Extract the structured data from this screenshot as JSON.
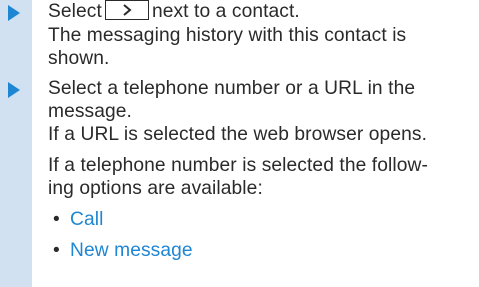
{
  "steps": [
    {
      "before_key": "Select",
      "key_icon": "chevron-right-icon",
      "after_key": "next to a contact.",
      "result": [
        "The messaging history with this contact is",
        "shown."
      ]
    },
    {
      "lines": [
        "Select a telephone number or a URL in the",
        "message."
      ],
      "result": [
        "If a URL is selected the web browser opens."
      ],
      "note": [
        "If a telephone number is selected the follow-",
        "ing options are available:"
      ]
    }
  ],
  "options": [
    "Call",
    "New message"
  ],
  "colors": {
    "accent": "#1f86d3",
    "sidebar": "#d2e1f2",
    "text": "#2a2a2a"
  }
}
